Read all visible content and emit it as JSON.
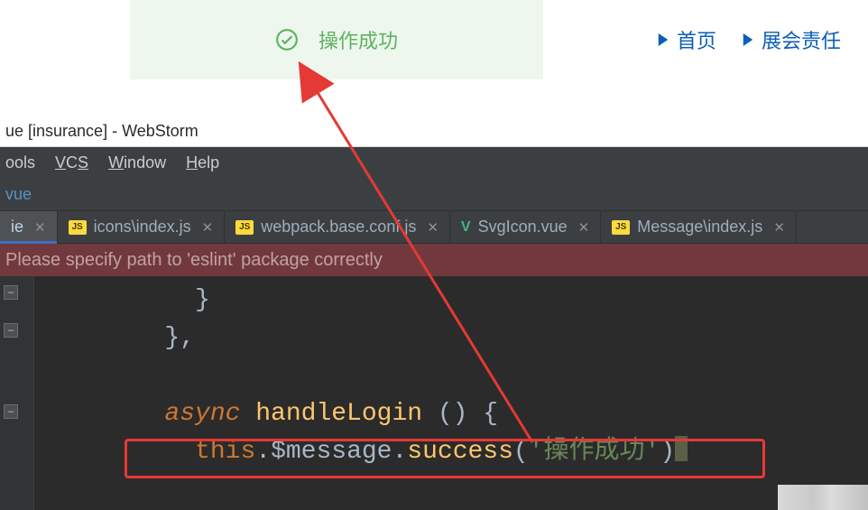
{
  "toast": {
    "text": "操作成功"
  },
  "nav": {
    "home": "首页",
    "expo": "展会责任"
  },
  "ide": {
    "title": "ue [insurance] - WebStorm",
    "menus": {
      "tools": "ools",
      "vcs": "VCS",
      "window": "Window",
      "help": "Help"
    },
    "crumb": "vue",
    "tabs": {
      "active": "ie",
      "icons": "icons\\index.js",
      "webpack": "webpack.base.conf.js",
      "svgicon": "SvgIcon.vue",
      "message": "Message\\index.js"
    },
    "eslint": "Please specify path to 'eslint' package correctly",
    "code": {
      "closeBrace1": "          }",
      "closeBrace2": "        },",
      "asyncLine": {
        "kw": "async",
        "fn": " handleLogin ",
        "rest": "() {"
      },
      "msgLine": {
        "thisk": "this",
        "dot1": ".",
        "msg": "$message",
        "dot2": ".",
        "call": "success",
        "lp": "(",
        "str": "'操作成功'",
        "rp": ")"
      }
    }
  }
}
